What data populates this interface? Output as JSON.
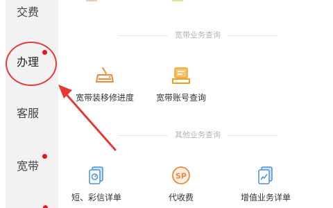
{
  "sidebar": {
    "items": [
      {
        "label": "交费",
        "badge": false
      },
      {
        "label": "办理",
        "badge": true
      },
      {
        "label": "客服",
        "badge": false
      },
      {
        "label": "宽带",
        "badge": true
      }
    ]
  },
  "sections": [
    {
      "title": "宽带业务查询",
      "items": [
        {
          "label": "宽带装移修进度",
          "icon": "router-icon"
        },
        {
          "label": "宽带账号查询",
          "icon": "account-card-icon"
        }
      ]
    },
    {
      "title": "其他业务查询",
      "items": [
        {
          "label": "短、彩信详单",
          "icon": "message-doc-icon"
        },
        {
          "label": "代收费",
          "icon": "sp-coin-icon"
        },
        {
          "label": "增值业务详单",
          "icon": "chart-doc-icon"
        }
      ]
    }
  ],
  "colors": {
    "accent_red": "#e53935",
    "badge_red": "#e8141f",
    "icon_orange": "#f0883a",
    "icon_blue": "#4a90d9"
  }
}
